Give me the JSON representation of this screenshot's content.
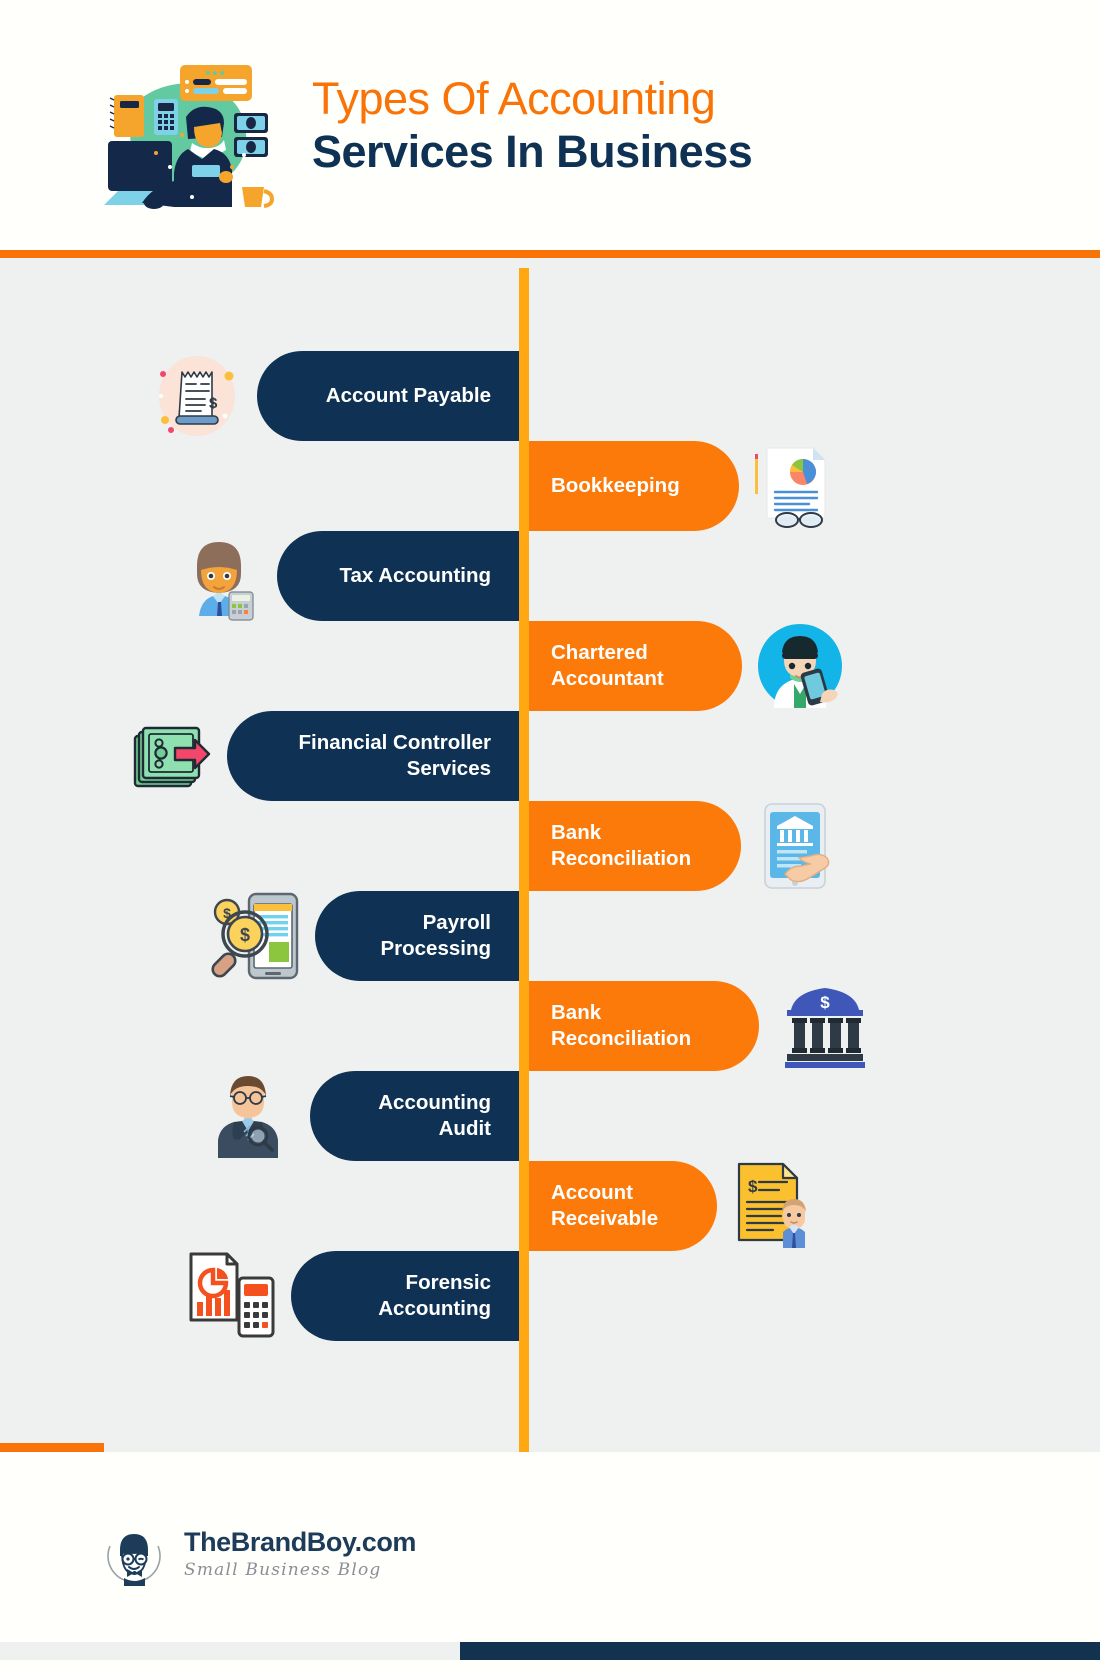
{
  "header": {
    "title_line1": "Types Of Accounting",
    "title_line2": "Services In Business",
    "illustration_name": "accountant-at-desk-illustration",
    "accent_color": "#F97306",
    "title_color_1": "#F97306",
    "title_color_2": "#0F3254"
  },
  "theme": {
    "background": "#FFFFFC",
    "body_background": "#EFF0F0",
    "timeline_color": "#FFA812",
    "pill_left_color": "#0F3254",
    "pill_right_color": "#FB7A09",
    "text_on_pill": "#FFFFFF"
  },
  "items": [
    {
      "label": "Account Payable",
      "side": "left",
      "icon": "receipt-invoice-icon"
    },
    {
      "label": "Bookkeeping",
      "side": "right",
      "icon": "report-chart-glasses-icon"
    },
    {
      "label": "Tax Accounting",
      "side": "left",
      "icon": "accountant-avatar-calculator-icon"
    },
    {
      "label": "Chartered Accountant",
      "side": "right",
      "icon": "accountant-circle-avatar-icon"
    },
    {
      "label": "Financial Controller Services",
      "side": "left",
      "icon": "cash-transfer-arrow-icon"
    },
    {
      "label": "Bank Reconciliation",
      "side": "right",
      "icon": "mobile-banking-hand-icon"
    },
    {
      "label": "Payroll Processing",
      "side": "left",
      "icon": "magnifier-coins-phone-icon"
    },
    {
      "label": "Bank Reconciliation",
      "side": "right",
      "icon": "bank-building-icon"
    },
    {
      "label": "Accounting Audit",
      "side": "left",
      "icon": "auditor-magnifier-icon"
    },
    {
      "label": "Account Receivable",
      "side": "right",
      "icon": "invoice-document-person-icon"
    },
    {
      "label": "Forensic Accounting",
      "side": "left",
      "icon": "report-pie-chart-calculator-icon"
    }
  ],
  "footer": {
    "brand_name": "TheBrandBoy.com",
    "tagline": "Small Business Blog",
    "logo_name": "brandboy-face-logo",
    "brand_color": "#1D3C59"
  }
}
